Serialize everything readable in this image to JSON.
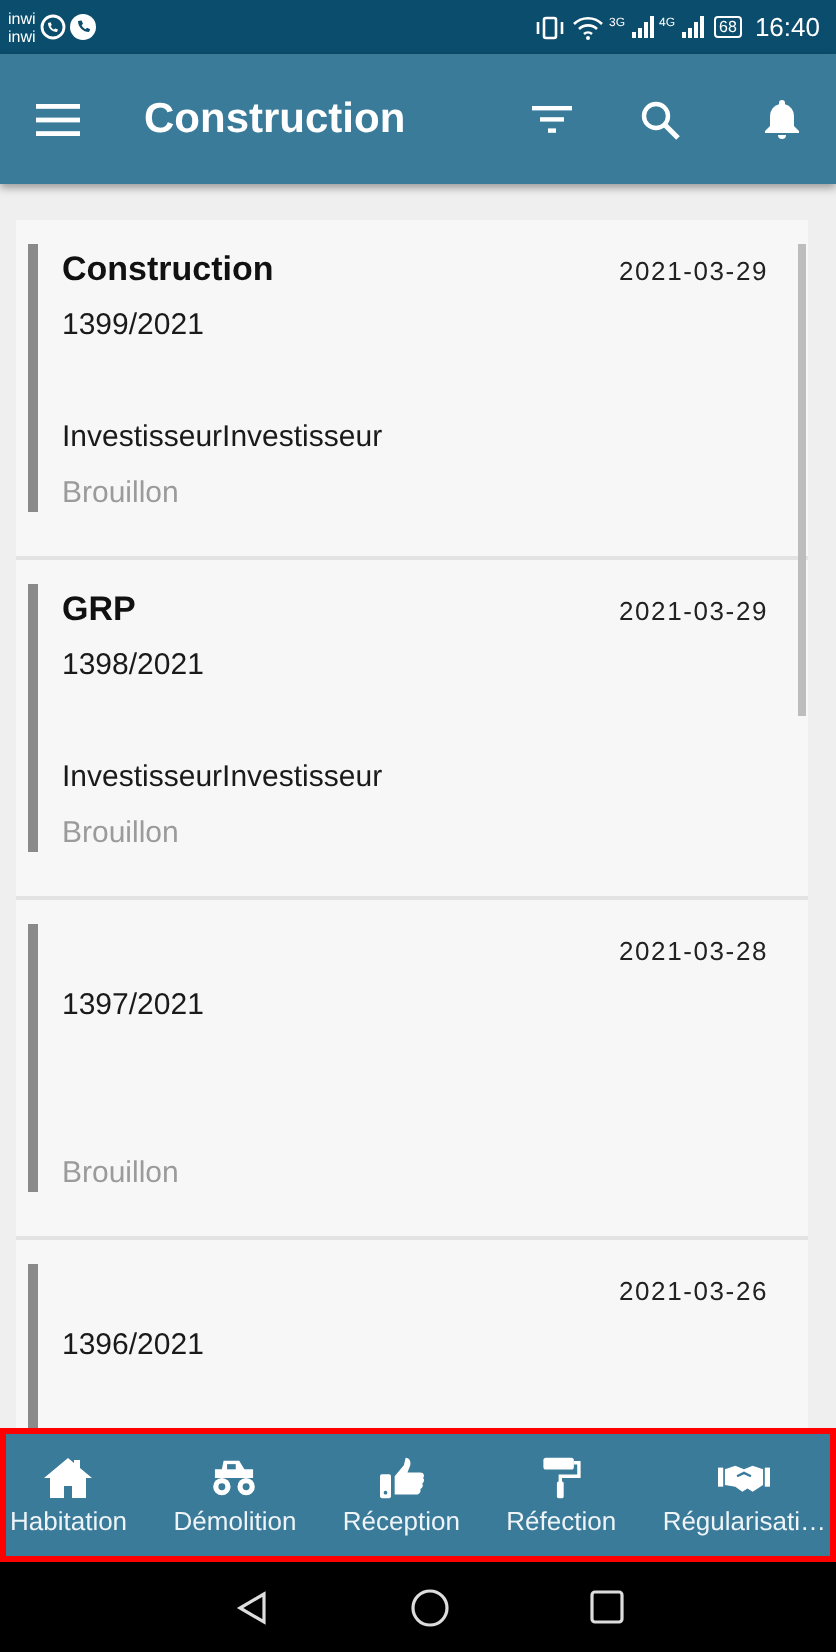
{
  "status_bar": {
    "carriers": [
      "inwi",
      "inwi"
    ],
    "networks": [
      "3G",
      "4G"
    ],
    "battery": "68",
    "time": "16:40"
  },
  "app_bar": {
    "title": "Construction"
  },
  "records": [
    {
      "title": "Construction",
      "date": "2021-03-29",
      "number": "1399/2021",
      "investor": "InvestisseurInvestisseur",
      "status": "Brouillon"
    },
    {
      "title": "GRP",
      "date": "2021-03-29",
      "number": "1398/2021",
      "investor": "InvestisseurInvestisseur",
      "status": "Brouillon"
    },
    {
      "date": "2021-03-28",
      "number": "1397/2021",
      "status": "Brouillon"
    },
    {
      "date": "2021-03-26",
      "number": "1396/2021"
    }
  ],
  "bottom_nav": [
    {
      "kind": "house",
      "label": "Habitation"
    },
    {
      "kind": "truck",
      "label": "Démolition"
    },
    {
      "kind": "thumb",
      "label": "Réception"
    },
    {
      "kind": "roller",
      "label": "Réfection"
    },
    {
      "kind": "handshake",
      "label": "Régularisati…"
    }
  ]
}
